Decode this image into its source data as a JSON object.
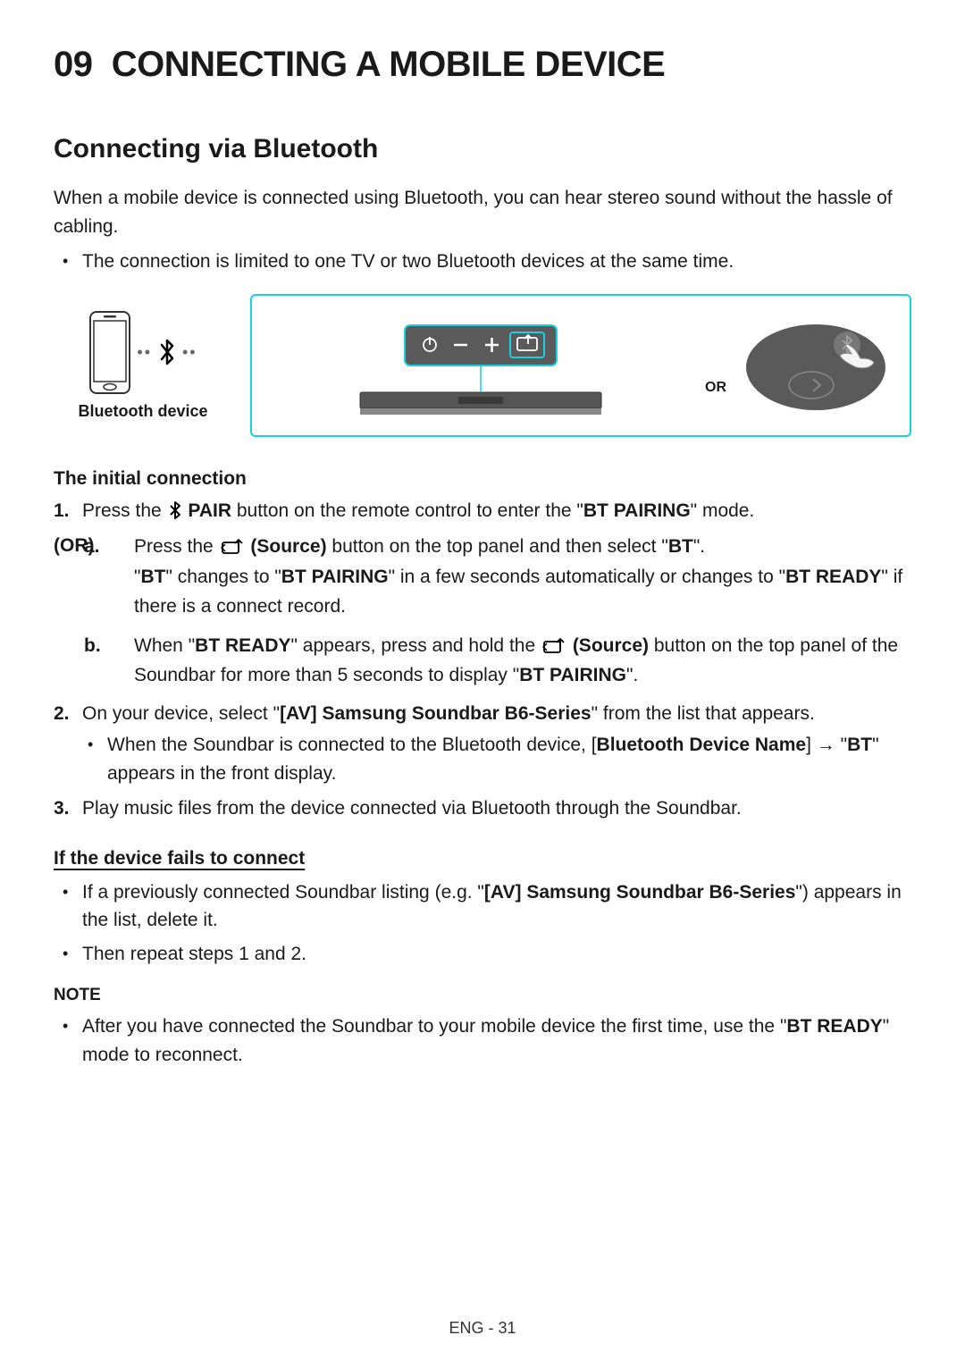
{
  "page": {
    "chapter_num": "09",
    "chapter_title": "CONNECTING A MOBILE DEVICE",
    "footer": "ENG - 31"
  },
  "section1": {
    "title": "Connecting via Bluetooth",
    "intro": "When a mobile device is connected using Bluetooth, you can hear stereo sound without the hassle of cabling.",
    "limit_note": "The connection is limited to one TV or two Bluetooth devices at the same time."
  },
  "diagram": {
    "bt_label": "Bluetooth device",
    "or_label": "OR"
  },
  "initial": {
    "heading": "The initial connection",
    "step1_pre": "Press the ",
    "step1_pair": " PAIR",
    "step1_post": " button on the remote control to enter the \"",
    "step1_mode": "BT PAIRING",
    "step1_end": "\" mode.",
    "or_label": "(OR)",
    "a_pre": "Press the ",
    "a_source": " (Source)",
    "a_mid": " button on the top panel and then select \"",
    "a_bt": "BT",
    "a_end": "\".",
    "a_line2_pre": "\"",
    "a_line2_bt": "BT",
    "a_line2_mid": "\" changes to \"",
    "a_line2_pair": "BT PAIRING",
    "a_line2_mid2": "\" in a few seconds automatically or changes to \"",
    "a_line2_ready": "BT READY",
    "a_line2_end": "\" if there is a connect record.",
    "b_pre": "When \"",
    "b_ready": "BT READY",
    "b_mid": "\" appears, press and hold the ",
    "b_source": " (Source)",
    "b_mid2": " button on the top panel of the Soundbar for more than 5 seconds to display \"",
    "b_pair": "BT PAIRING",
    "b_end": "\".",
    "step2_pre": "On your device, select \"",
    "step2_name": "[AV] Samsung Soundbar B6-Series",
    "step2_end": "\" from the list that appears.",
    "step2_sub_pre": "When the Soundbar is connected to the Bluetooth device, [",
    "step2_sub_bdn": "Bluetooth Device Name",
    "step2_sub_arrow": "] → \"",
    "step2_sub_bt": "BT",
    "step2_sub_end": "\" appears in the front display.",
    "step3": "Play music files from the device connected via Bluetooth through the Soundbar."
  },
  "fails": {
    "heading": "If the device fails to connect",
    "item1_pre": "If a previously connected Soundbar listing (e.g. \"",
    "item1_name": "[AV] Samsung Soundbar B6-Series",
    "item1_end": "\") appears in the list, delete it.",
    "item2": "Then repeat steps 1 and 2."
  },
  "note": {
    "heading": "NOTE",
    "item1_pre": "After you have connected the Soundbar to your mobile device the first time, use the \"",
    "item1_ready": "BT READY",
    "item1_end": "\" mode to reconnect."
  }
}
